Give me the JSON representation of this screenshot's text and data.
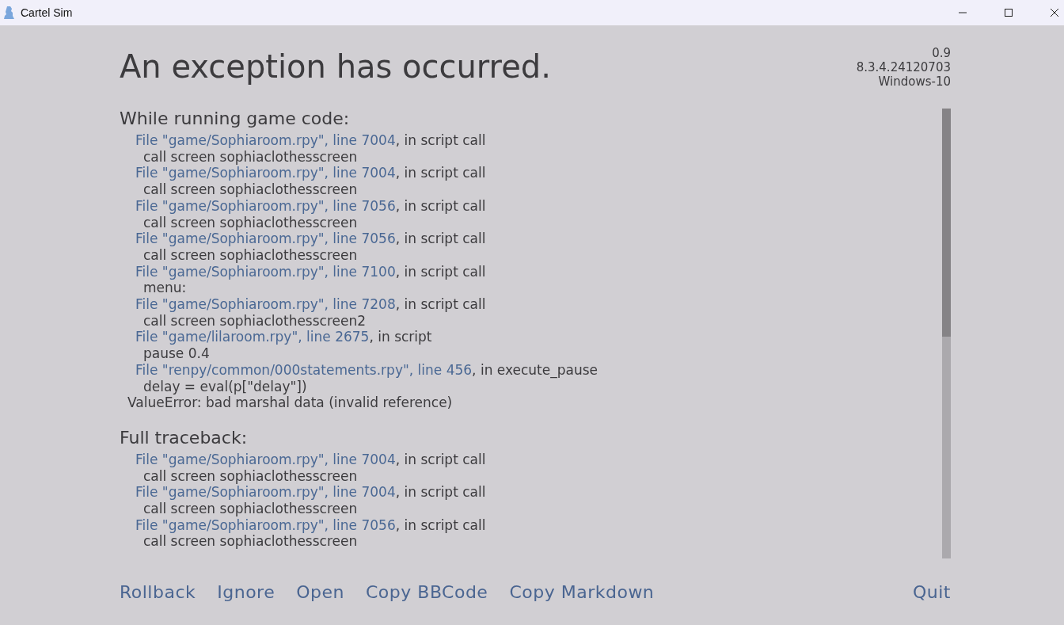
{
  "window": {
    "title": "Cartel Sim"
  },
  "heading": "An exception has occurred.",
  "version_info": [
    "0.9",
    "8.3.4.24120703",
    "Windows-10"
  ],
  "sections": [
    {
      "heading": "While running game code:",
      "frames": [
        {
          "file": "File \"game/Sophiaroom.rpy\", line 7004",
          "rest": ", in script call",
          "code": "call screen sophiaclothesscreen"
        },
        {
          "file": "File \"game/Sophiaroom.rpy\", line 7004",
          "rest": ", in script call",
          "code": "call screen sophiaclothesscreen"
        },
        {
          "file": "File \"game/Sophiaroom.rpy\", line 7056",
          "rest": ", in script call",
          "code": "call screen sophiaclothesscreen"
        },
        {
          "file": "File \"game/Sophiaroom.rpy\", line 7056",
          "rest": ", in script call",
          "code": "call screen sophiaclothesscreen"
        },
        {
          "file": "File \"game/Sophiaroom.rpy\", line 7100",
          "rest": ", in script call",
          "code": "menu:"
        },
        {
          "file": "File \"game/Sophiaroom.rpy\", line 7208",
          "rest": ", in script call",
          "code": "call screen sophiaclothesscreen2"
        },
        {
          "file": "File \"game/lilaroom.rpy\", line 2675",
          "rest": ", in script",
          "code": "pause 0.4"
        },
        {
          "file": "File \"renpy/common/000statements.rpy\", line 456",
          "rest": ", in execute_pause",
          "code": "delay = eval(p[\"delay\"])"
        }
      ],
      "error": "ValueError: bad marshal data (invalid reference)"
    },
    {
      "heading": "Full traceback:",
      "frames": [
        {
          "file": "File \"game/Sophiaroom.rpy\", line 7004",
          "rest": ", in script call",
          "code": "call screen sophiaclothesscreen"
        },
        {
          "file": "File \"game/Sophiaroom.rpy\", line 7004",
          "rest": ", in script call",
          "code": "call screen sophiaclothesscreen"
        },
        {
          "file": "File \"game/Sophiaroom.rpy\", line 7056",
          "rest": ", in script call",
          "code": "call screen sophiaclothesscreen"
        }
      ]
    }
  ],
  "actions": [
    "Rollback",
    "Ignore",
    "Open",
    "Copy BBCode",
    "Copy Markdown"
  ],
  "quit": "Quit"
}
